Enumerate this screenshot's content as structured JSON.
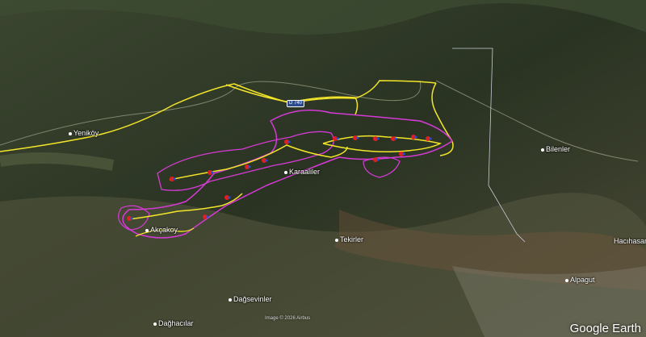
{
  "places": [
    {
      "id": "yenikoy",
      "label": "Yeniköy"
    },
    {
      "id": "karaaliler",
      "label": "Karaaliler"
    },
    {
      "id": "akcakoy",
      "label": "Akçakoy"
    },
    {
      "id": "tekirler",
      "label": "Tekirler"
    },
    {
      "id": "alpagut",
      "label": "Alpagut"
    },
    {
      "id": "hacihasan",
      "label": "Hacıhasan"
    },
    {
      "id": "dagsevinler",
      "label": "Dağsevinler"
    },
    {
      "id": "daghacilar",
      "label": "Dağhacılar"
    },
    {
      "id": "bilenler",
      "label": "Bilenler"
    }
  ],
  "road_shield": "D 740",
  "attribution": "Image © 2026 Airbus",
  "brand": "Google Earth",
  "colors": {
    "track": "#f2e52a",
    "zone": "#d63ad6",
    "border": "#c9ccd8",
    "marker_red": "#e02020",
    "marker_blue": "#2050e0"
  }
}
